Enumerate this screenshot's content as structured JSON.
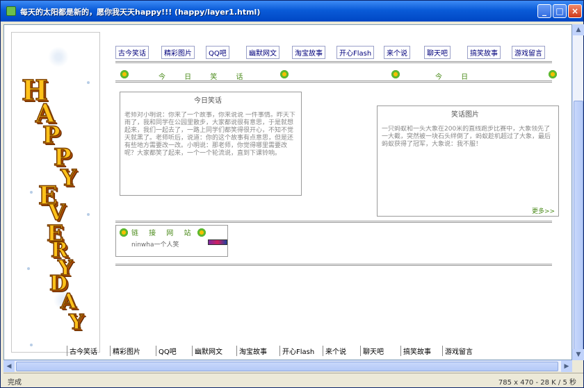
{
  "window": {
    "title": "每天的太阳都是新的，愿你我天天happy!!!  (happy/layer1.html)"
  },
  "nav": [
    "古今笑话",
    "精彩图片",
    "QQ吧",
    "幽默网文",
    "淘宝故事",
    "开心Flash",
    "来个说",
    "聊天吧",
    "搞笑故事",
    "游戏留言"
  ],
  "today_left": "今 日 笑 话",
  "today_right": "今 日 ",
  "left_box": {
    "title": "今日笑话",
    "body": "老师对小明说：你来了一个故事，你来说说 一件事情。昨天下雨了，我和同学在公园里散步，大家都说很有意思，于是就想起来，我们一起去了，一路上同学们都笑得很开心，不知不觉天就黑了。老师听后，说道：你的这个故事有点意思，但是还有些地方需要改一改。小明说：那老师，你觉得哪里需要改呢？大家都笑了起来，一个一个轮流说，直到下课铃响。"
  },
  "right_box": {
    "title": "笑话图片",
    "body": "一只蚂蚁和一头大象在200米的直线跑步比赛中，大象领先了一大截，突然被一块石头绊倒了，蚂蚁趁机超过了大象，最后蚂蚁获得了冠军，大象说：我不服！",
    "more": "更多>>"
  },
  "friends": {
    "label": "链 接 网 站",
    "link": "ninwha一个人笑"
  },
  "bottom_nav": [
    "古今笑话",
    "精彩图片",
    "QQ吧",
    "幽默网文",
    "淘宝故事",
    "开心Flash",
    "来个说",
    "聊天吧",
    "搞笑故事",
    "游戏留言"
  ],
  "deco": {
    "word1": [
      "H",
      "A",
      "P",
      "P",
      "Y"
    ],
    "word2": [
      "E",
      "V",
      "E",
      "R",
      "Y",
      "D",
      "A",
      "Y"
    ]
  },
  "status": {
    "left": "完成",
    "right": "785 x 470 - 28 K / 5 秒"
  },
  "colors": {
    "titlebar": "#0a5bd8",
    "nav_link": "#00007c",
    "accent_green": "#4a8a1a",
    "letter_fill": "#ffc21a"
  }
}
